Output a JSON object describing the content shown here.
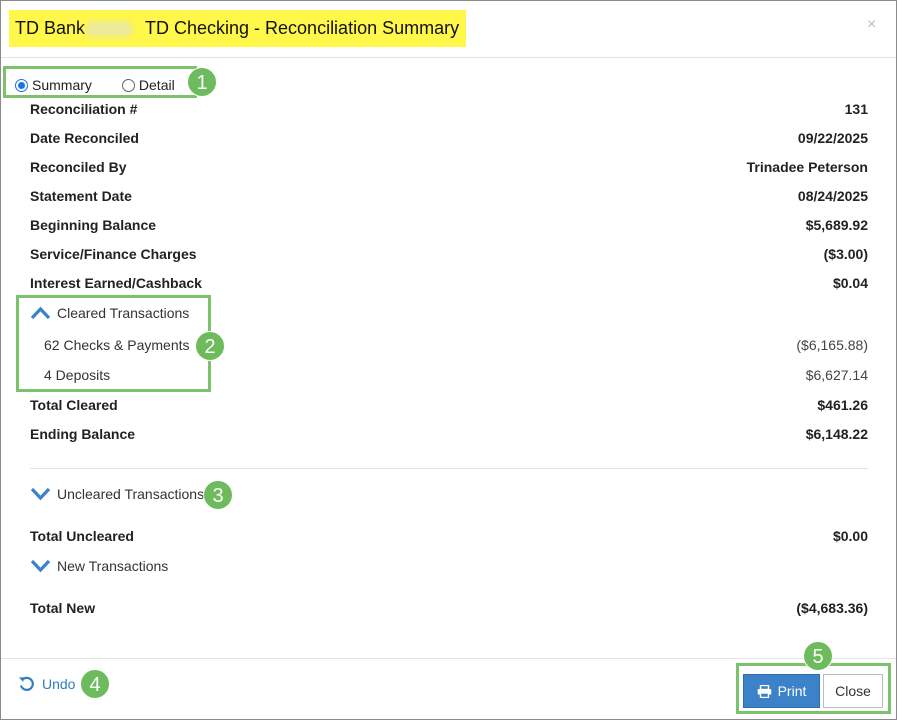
{
  "dialog": {
    "title_bank": "TD Bank",
    "title_account": "TD Checking - Reconciliation Summary",
    "close_symbol": "×",
    "highlight_color": "#fff84a"
  },
  "view_toggle": {
    "options": [
      {
        "label": "Summary",
        "selected": true
      },
      {
        "label": "Detail",
        "selected": false
      }
    ]
  },
  "summary": [
    {
      "label": "Reconciliation #",
      "value": "131"
    },
    {
      "label": "Date Reconciled",
      "value": "09/22/2025"
    },
    {
      "label": "Reconciled By",
      "value": "Trinadee Peterson"
    },
    {
      "label": "Statement Date",
      "value": "08/24/2025"
    },
    {
      "label": "Beginning Balance",
      "value": "$5,689.92"
    },
    {
      "label": "Service/Finance Charges",
      "value": "($3.00)"
    },
    {
      "label": "Interest Earned/Cashback",
      "value": "$0.04"
    }
  ],
  "cleared": {
    "toggle_label": "Cleared Transactions",
    "expanded": true,
    "items": [
      {
        "label": "62 Checks & Payments",
        "value": "($6,165.88)"
      },
      {
        "label": "4 Deposits",
        "value": "$6,627.14"
      }
    ],
    "total_label": "Total Cleared",
    "total_value": "$461.26",
    "ending_label": "Ending Balance",
    "ending_value": "$6,148.22"
  },
  "uncleared": {
    "toggle_label": "Uncleared Transactions",
    "expanded": false,
    "total_label": "Total Uncleared",
    "total_value": "$0.00"
  },
  "new_transactions": {
    "toggle_label": "New Transactions",
    "expanded": false,
    "total_label": "Total New",
    "total_value": "($4,683.36)"
  },
  "footer": {
    "undo_label": "Undo",
    "print_label": "Print",
    "close_label": "Close"
  },
  "callouts": [
    "1",
    "2",
    "3",
    "4",
    "5"
  ],
  "colors": {
    "accent": "#3b82c8",
    "callout_green": "#6dbb5c",
    "link": "#2f7ec2"
  }
}
